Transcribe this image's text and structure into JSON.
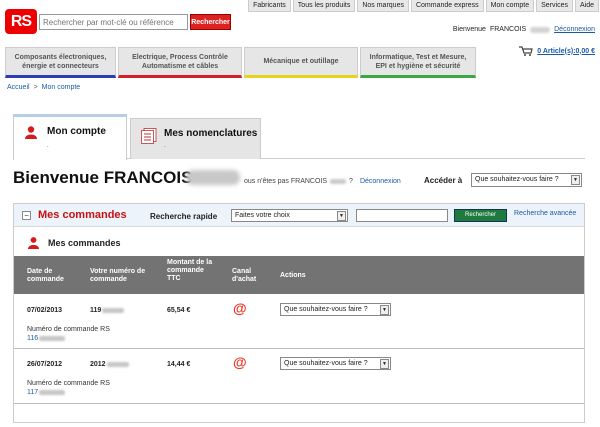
{
  "header": {
    "logo": "RS",
    "search_placeholder": "Rechercher par mot-clé ou référence",
    "search_button": "Rechercher",
    "top_links": [
      "Fabricants",
      "Tous les produits",
      "Nos marques",
      "Commande express",
      "Mon compte",
      "Services",
      "Aide"
    ],
    "welcome": "Bienvenue",
    "user": "FRANCOIS",
    "logout": "Déconnexion"
  },
  "categories": [
    {
      "label": "Composants électroniques, énergie et connecteurs",
      "color": "#2e3bb6"
    },
    {
      "label": "Electrique, Process Contrôle Automatisme et câbles",
      "color": "#d51f26"
    },
    {
      "label": "Mécanique et outillage",
      "color": "#e7d31b"
    },
    {
      "label": "Informatique, Test et Mesure, EPI et hygiène et sécurité",
      "color": "#3ba845"
    }
  ],
  "cart": {
    "label": "0 Article(s):0,00 €"
  },
  "breadcrumb": {
    "home": "Accueil",
    "sep": ">",
    "current": "Mon compte"
  },
  "tabs": [
    {
      "title": "Mon compte",
      "sub": "."
    },
    {
      "title": "Mes nomenclatures",
      "sub": "."
    }
  ],
  "welcome_section": {
    "heading": "Bienvenue FRANCOIS",
    "not_you_prefix": "ous n'êtes pas FRANCOIS",
    "not_you_suffix": "?",
    "logout": "Déconnexion",
    "access_label": "Accéder à",
    "access_value": "Que souhaitez-vous faire ?"
  },
  "orders": {
    "title": "Mes commandes",
    "quick_search_label": "Recherche rapide",
    "quick_search_value": "Faites votre choix",
    "search_button": "Rechercher",
    "advanced_link": "Recherche avancée",
    "sub_title": "Mes commandes",
    "columns": [
      "Date de commande",
      "Votre numéro de commande",
      "Montant de la commande TTC",
      "Canal d'achat",
      "Actions"
    ],
    "rows": [
      {
        "date": "07/02/2013",
        "number_prefix": "119",
        "amount": "65,54 €",
        "channel_icon": "@",
        "action": "Que souhaitez-vous faire ?",
        "rs_label": "Numéro de commande RS",
        "rs_prefix": "116"
      },
      {
        "date": "26/07/2012",
        "number_prefix": "2012",
        "amount": "14,44 €",
        "channel_icon": "@",
        "action": "Que souhaitez-vous faire ?",
        "rs_label": "Numéro de commande RS",
        "rs_prefix": "117"
      }
    ]
  }
}
